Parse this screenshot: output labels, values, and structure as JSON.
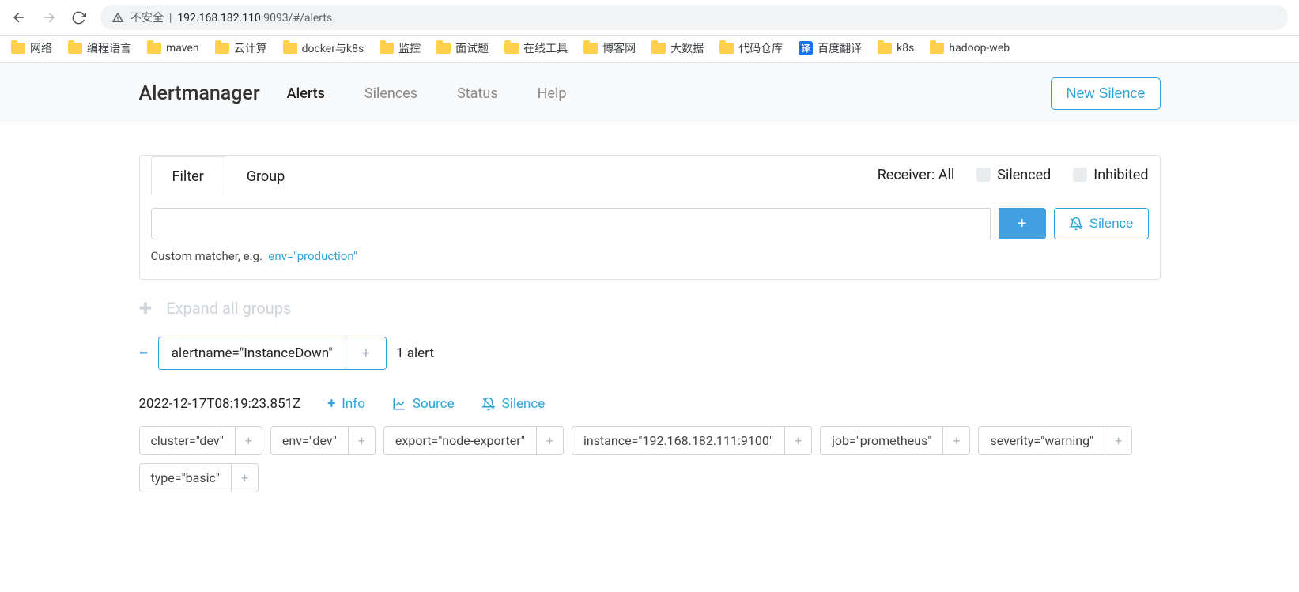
{
  "browser": {
    "insecure_label": "不安全",
    "url_host": "192.168.182.110",
    "url_port_path": ":9093/#/alerts"
  },
  "bookmarks": [
    {
      "label": "网络",
      "type": "folder"
    },
    {
      "label": "编程语言",
      "type": "folder"
    },
    {
      "label": "maven",
      "type": "folder"
    },
    {
      "label": "云计算",
      "type": "folder"
    },
    {
      "label": "docker与k8s",
      "type": "folder"
    },
    {
      "label": "监控",
      "type": "folder"
    },
    {
      "label": "面试题",
      "type": "folder"
    },
    {
      "label": "在线工具",
      "type": "folder"
    },
    {
      "label": "博客网",
      "type": "folder"
    },
    {
      "label": "大数据",
      "type": "folder"
    },
    {
      "label": "代码仓库",
      "type": "folder"
    },
    {
      "label": "百度翻译",
      "type": "translate"
    },
    {
      "label": "k8s",
      "type": "folder"
    },
    {
      "label": "hadoop-web",
      "type": "folder"
    }
  ],
  "nav": {
    "brand": "Alertmanager",
    "links": [
      "Alerts",
      "Silences",
      "Status",
      "Help"
    ],
    "active_index": 0,
    "new_silence_label": "New Silence"
  },
  "filter_card": {
    "tabs": [
      "Filter",
      "Group"
    ],
    "active_tab": 0,
    "receiver_label": "Receiver: All",
    "silenced_label": "Silenced",
    "inhibited_label": "Inhibited",
    "filter_value": "",
    "add_label": "+",
    "silence_btn_label": "Silence",
    "hint_prefix": "Custom matcher, e.g.",
    "hint_example": "env=\"production\""
  },
  "expand_label": "Expand all groups",
  "group": {
    "matcher": "alertname=\"InstanceDown\"",
    "count_label": "1 alert"
  },
  "detail": {
    "timestamp": "2022-12-17T08:19:23.851Z",
    "info_label": "Info",
    "source_label": "Source",
    "silence_label": "Silence"
  },
  "labels": [
    "cluster=\"dev\"",
    "env=\"dev\"",
    "export=\"node-exporter\"",
    "instance=\"192.168.182.111:9100\"",
    "job=\"prometheus\"",
    "severity=\"warning\"",
    "type=\"basic\""
  ]
}
